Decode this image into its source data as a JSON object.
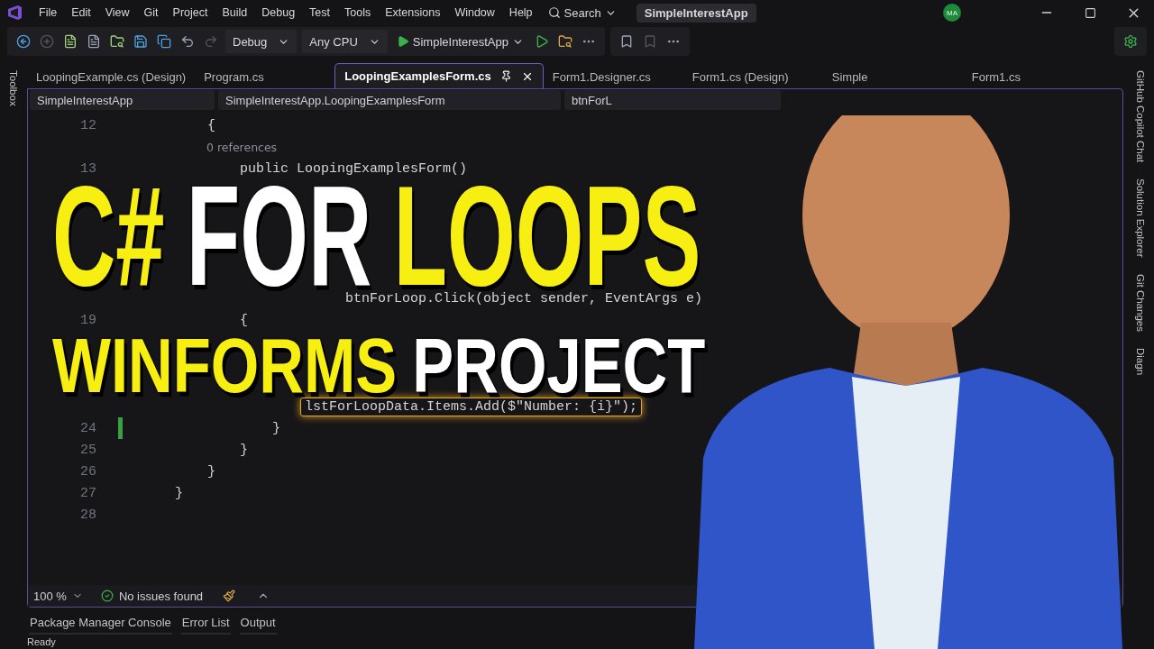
{
  "menu": [
    "File",
    "Edit",
    "View",
    "Git",
    "Project",
    "Build",
    "Debug",
    "Test",
    "Tools",
    "Extensions",
    "Window",
    "Help"
  ],
  "search": {
    "label": "Search"
  },
  "solution_title": "SimpleInterestApp",
  "account": {
    "initials": "MA"
  },
  "toolbar": {
    "configuration": "Debug",
    "platform": "Any CPU",
    "startup_project": "SimpleInterestApp"
  },
  "side_tabs_left": [
    "Toolbox"
  ],
  "tabs": [
    {
      "label": "LoopingExample.cs (Design)",
      "selected": false
    },
    {
      "label": "Program.cs",
      "selected": false
    },
    {
      "label": "LoopingExamplesForm.cs",
      "selected": true
    },
    {
      "label": "Form1.Designer.cs",
      "selected": false
    },
    {
      "label": "Form1.cs (Design)",
      "selected": false
    },
    {
      "label": "Simple",
      "selected": false
    },
    {
      "label": "Form1.cs",
      "selected": false
    }
  ],
  "navigation": [
    "SimpleInterestApp",
    "SimpleInterestApp.LoopingExamplesForm",
    "btnForL"
  ],
  "code_rows": [
    {
      "kind": "line",
      "number": "12",
      "code": "    {"
    },
    {
      "kind": "lens",
      "text": "0 references"
    },
    {
      "kind": "line",
      "number": "13",
      "code": "        public LoopingExamplesForm()"
    },
    {
      "kind": "gap"
    },
    {
      "kind": "gap"
    },
    {
      "kind": "gap"
    },
    {
      "kind": "gap"
    },
    {
      "kind": "gap"
    },
    {
      "kind": "line",
      "code": "                     btnForLoop.Click(object sender, EventArgs e)"
    },
    {
      "kind": "line",
      "number": "19",
      "code": "        {"
    },
    {
      "kind": "gap"
    },
    {
      "kind": "gap"
    },
    {
      "kind": "gap"
    },
    {
      "kind": "line",
      "code": "                lstForLoopData.Items.Add($\"Number: {i}\");",
      "highlighted": true
    },
    {
      "kind": "line",
      "number": "24",
      "code": "            }",
      "changed": true
    },
    {
      "kind": "line",
      "number": "25",
      "code": "        }"
    },
    {
      "kind": "line",
      "number": "26",
      "code": "    }"
    },
    {
      "kind": "line",
      "number": "27",
      "code": "}"
    },
    {
      "kind": "line",
      "number": "28"
    }
  ],
  "editor_status": {
    "zoom": "100 %",
    "issues": "No issues found"
  },
  "side_tabs_right": [
    "GitHub Copilot Chat",
    "Solution Explorer",
    "Git Changes",
    "Diagn"
  ],
  "bottom_tabs": [
    "Package Manager Console",
    "Error List",
    "Output"
  ],
  "status_bar": {
    "text": "Ready"
  },
  "headline": {
    "lines": [
      [
        {
          "text": "C#",
          "highlight": true
        },
        {
          "text": "FOR",
          "highlight": false
        },
        {
          "text": "LOOPS",
          "highlight": true
        }
      ],
      [
        {
          "text": "WINFORMS",
          "highlight": true
        },
        {
          "text": "PROJECT",
          "highlight": false
        }
      ]
    ]
  }
}
